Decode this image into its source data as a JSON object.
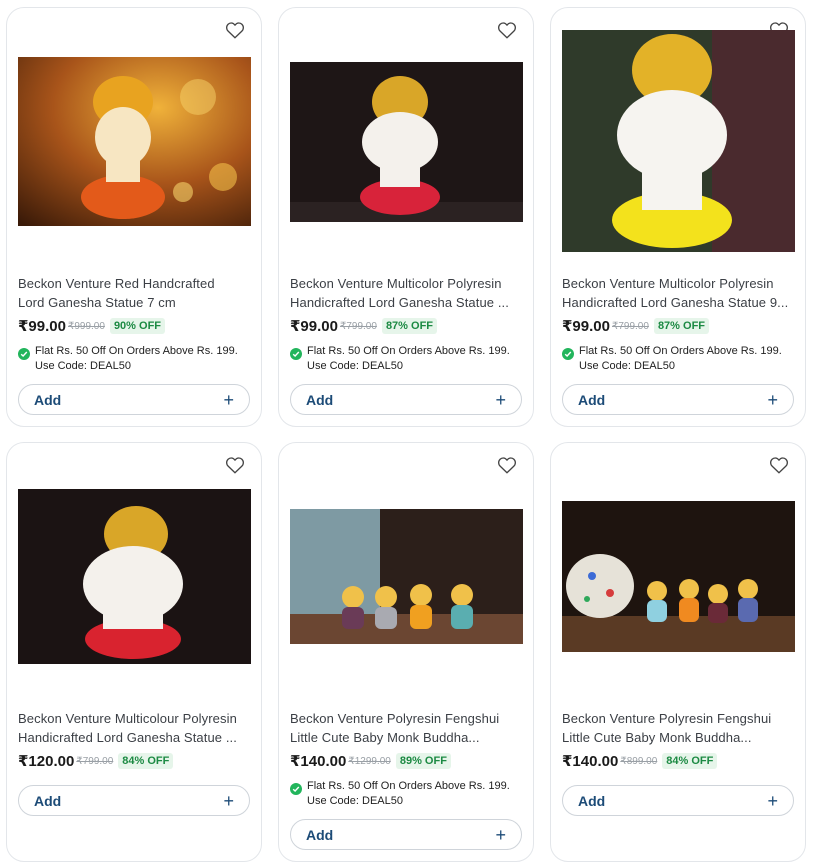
{
  "products": [
    {
      "title_line1": "Beckon Venture Red Handcrafted",
      "title_line2": "Lord Ganesha Statue 7 cm",
      "price": "₹99.00",
      "mrp": "₹999.00",
      "discount": "90% OFF",
      "offer_line1": "Flat Rs. 50 Off On Orders Above Rs. 199.",
      "offer_line2": "Use Code: DEAL50",
      "add_label": "Add",
      "image_icon": "ganesha-statue-red"
    },
    {
      "title_line1": "Beckon Venture Multicolor Polyresin",
      "title_line2": "Handicrafted Lord Ganesha Statue ...",
      "price": "₹99.00",
      "mrp": "₹799.00",
      "discount": "87% OFF",
      "offer_line1": "Flat Rs. 50 Off On Orders Above Rs. 199.",
      "offer_line2": "Use Code: DEAL50",
      "add_label": "Add",
      "image_icon": "ganesha-statue-white"
    },
    {
      "title_line1": "Beckon Venture Multicolor Polyresin",
      "title_line2": "Handicrafted Lord Ganesha Statue 9...",
      "price": "₹99.00",
      "mrp": "₹799.00",
      "discount": "87% OFF",
      "offer_line1": "Flat Rs. 50 Off On Orders Above Rs. 199.",
      "offer_line2": "Use Code: DEAL50",
      "add_label": "Add",
      "image_icon": "ganesha-statue-yellow"
    },
    {
      "title_line1": "Beckon Venture Multicolour Polyresin",
      "title_line2": "Handicrafted Lord Ganesha Statue ...",
      "price": "₹120.00",
      "mrp": "₹799.00",
      "discount": "84% OFF",
      "add_label": "Add",
      "image_icon": "ganesha-statue-red-white"
    },
    {
      "title_line1": "Beckon Venture Polyresin Fengshui",
      "title_line2": "Little Cute Baby Monk Buddha...",
      "price": "₹140.00",
      "mrp": "₹1299.00",
      "discount": "89% OFF",
      "offer_line1": "Flat Rs. 50 Off On Orders Above Rs. 199.",
      "offer_line2": "Use Code: DEAL50",
      "add_label": "Add",
      "image_icon": "baby-monk-figurines"
    },
    {
      "title_line1": "Beckon Venture Polyresin Fengshui",
      "title_line2": "Little Cute Baby Monk Buddha...",
      "price": "₹140.00",
      "mrp": "₹899.00",
      "discount": "84% OFF",
      "add_label": "Add",
      "image_icon": "baby-monk-figurines-with-lantern"
    }
  ],
  "colors": {
    "price_text": "#1a1a1a",
    "discount_text": "#1c8a43",
    "discount_bg": "#e6f5ea",
    "add_text": "#1c4b77",
    "offer_icon": "#22b55c"
  }
}
